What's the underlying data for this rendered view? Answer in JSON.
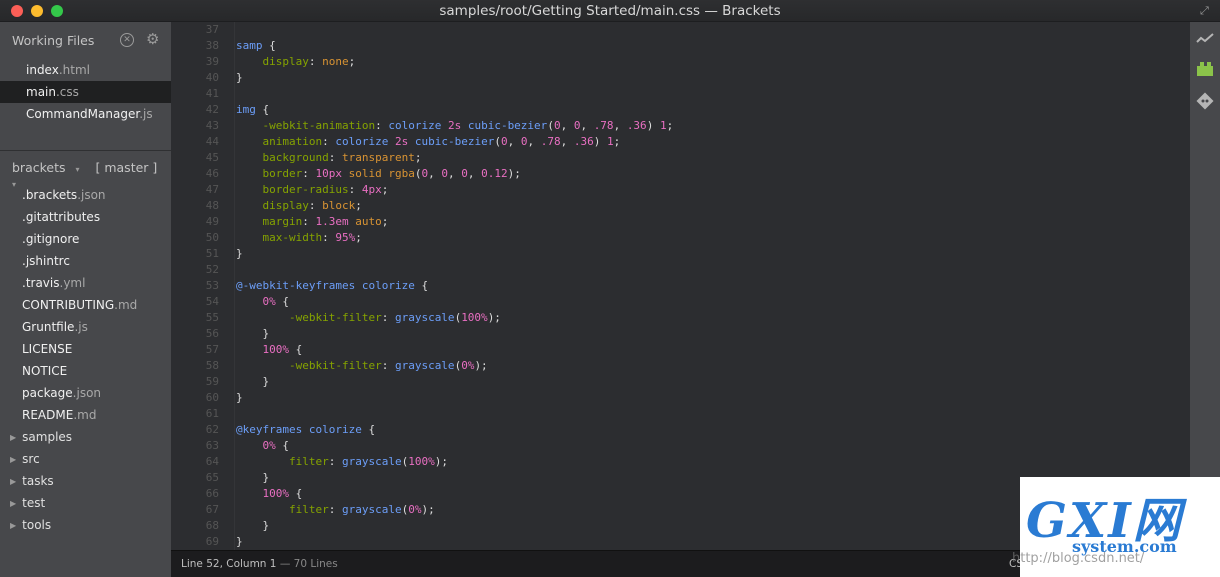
{
  "window": {
    "title": "samples/root/Getting Started/main.css — Brackets"
  },
  "sidebar": {
    "working_files_label": "Working Files",
    "working_files": [
      {
        "name": "index",
        "ext": ".html"
      },
      {
        "name": "main",
        "ext": ".css"
      },
      {
        "name": "CommandManager",
        "ext": ".js"
      }
    ],
    "project_name": "brackets",
    "branch": "[ master ]",
    "tree_files": [
      {
        "name": ".brackets",
        "ext": ".json"
      },
      {
        "name": ".gitattributes",
        "ext": ""
      },
      {
        "name": ".gitignore",
        "ext": ""
      },
      {
        "name": ".jshintrc",
        "ext": ""
      },
      {
        "name": ".travis",
        "ext": ".yml"
      },
      {
        "name": "CONTRIBUTING",
        "ext": ".md"
      },
      {
        "name": "Gruntfile",
        "ext": ".js"
      },
      {
        "name": "LICENSE",
        "ext": ""
      },
      {
        "name": "NOTICE",
        "ext": ""
      },
      {
        "name": "package",
        "ext": ".json"
      },
      {
        "name": "README",
        "ext": ".md"
      }
    ],
    "tree_folders": [
      "samples",
      "src",
      "tasks",
      "test",
      "tools"
    ]
  },
  "editor": {
    "line_numbers": [
      "37",
      "38",
      "39",
      "40",
      "41",
      "42",
      "43",
      "44",
      "45",
      "46",
      "47",
      "48",
      "49",
      "50",
      "51",
      "52",
      "53",
      "54",
      "55",
      "56",
      "57",
      "58",
      "59",
      "60",
      "61",
      "62",
      "63",
      "64",
      "65",
      "66",
      "67",
      "68",
      "69"
    ]
  },
  "status": {
    "position": "Line 52, Column 1",
    "lines": " — 70 Lines",
    "mode": "CSS"
  },
  "toolbar": {
    "icons": [
      "live-preview-icon",
      "extension-manager-icon",
      "git-icon"
    ]
  },
  "watermark": {
    "logo": "GXI网",
    "site": "system.com",
    "url": "http://blog.csdn.net/"
  },
  "colors": {
    "sidebar_bg": "#47484b",
    "editor_bg": "#2c2d30",
    "selector": "#6c9ef8",
    "property": "#85a300",
    "value": "#d89333",
    "number": "#e96fc2"
  }
}
